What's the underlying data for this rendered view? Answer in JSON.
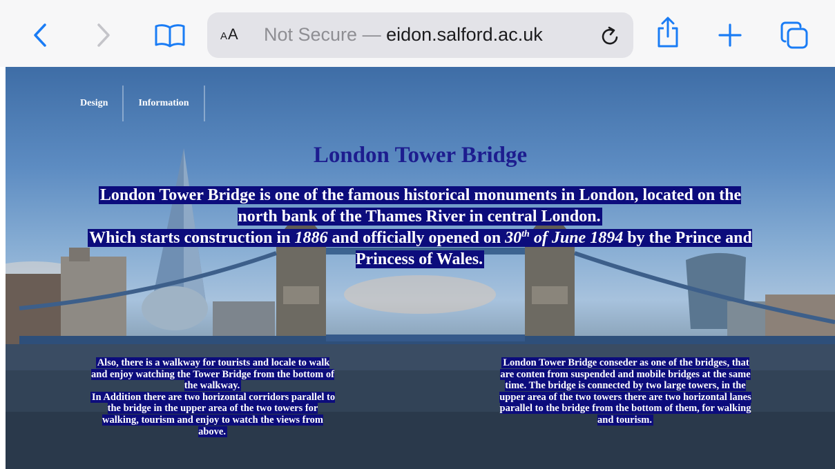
{
  "browser": {
    "text_size_label": "AA",
    "address_prefix": "Not Secure — ",
    "address_domain": "eidon.salford.ac.uk",
    "icons": [
      "back-icon",
      "forward-icon",
      "bookmarks-icon",
      "reload-icon",
      "share-icon",
      "new-tab-icon",
      "tabs-icon"
    ],
    "accent_color": "#1a7cf5"
  },
  "nav": {
    "items": [
      "Design",
      "Information"
    ]
  },
  "main": {
    "title": "London Tower Bridge",
    "intro_line1": "London Tower Bridge is one of the famous historical monuments in London, located on the north bank of the Thames River in central London.",
    "intro_line2_a": "Which starts construction in ",
    "intro_year_start": "1886",
    "intro_line2_b": " and officially opened on ",
    "intro_date_day": "30",
    "intro_date_suffix": "th",
    "intro_date_rest": " of June 1894",
    "intro_line2_c": " by the Prince and Princess of Wales.",
    "left_paragraph_1": "Also, there is a walkway for tourists and locale to walk and enjoy watching the Tower Bridge from the bottom of the walkway.",
    "left_paragraph_2": "In Addition there are two horizontal corridors parallel to the bridge in the upper area of the two towers for walking, tourism and enjoy to watch the views from above.",
    "right_paragraph": "London Tower Bridge conseder as one of the bridges, that are conten from suspended and mobile bridges at the same time. The bridge is connected by two large towers, in the upper area of the two towers there are two horizontal lanes parallel to the bridge from the bottom of them, for walking and tourism.",
    "highlight_color": "#0c0c7c",
    "title_color": "#1d1d8f"
  }
}
